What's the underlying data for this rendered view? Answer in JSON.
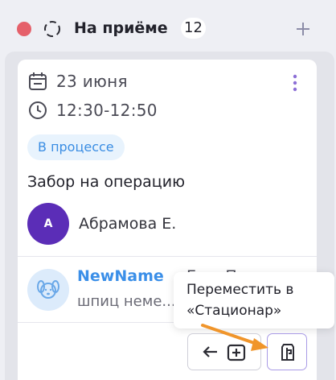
{
  "column": {
    "title": "На приёме",
    "count": "12",
    "status_color": "#e5606a"
  },
  "card": {
    "date": "23 июня",
    "time": "12:30-12:50",
    "status": "В процессе",
    "title": "Забор на операцию",
    "owner": {
      "initial": "А",
      "name": "Абрамова Е.",
      "avatar_color": "#5b2db7"
    },
    "pet": {
      "name": "NewName",
      "extra": "Бу...  П...",
      "breed": "шпиц неме..."
    }
  },
  "tooltip": {
    "line1": "Переместить в",
    "line2": "«Стационар»"
  },
  "icons": {
    "calendar": "calendar-icon",
    "clock": "clock-icon",
    "more": "more-vertical-icon",
    "dog": "dog-icon",
    "back": "arrow-left-icon",
    "medical": "medical-plus-icon",
    "hospital": "hospital-move-icon",
    "add": "plus-icon",
    "spinner": "dashed-circle-icon"
  },
  "colors": {
    "accent_blue": "#3b8fe8",
    "annotation_orange": "#f0952b",
    "move_border": "#a99be6"
  }
}
